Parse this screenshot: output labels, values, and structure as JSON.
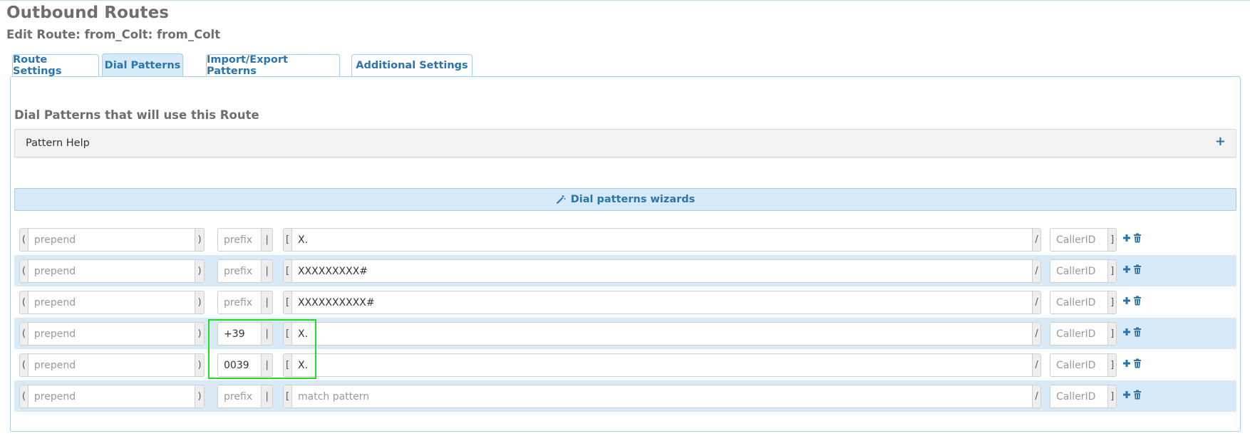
{
  "page": {
    "title": "Outbound Routes",
    "subtitle": "Edit Route: from_Colt: from_Colt"
  },
  "tabs": [
    {
      "label": "Route Settings",
      "active": false
    },
    {
      "label": "Dial Patterns",
      "active": true
    },
    {
      "label": "Import/Export Patterns",
      "active": false
    },
    {
      "label": "Additional Settings",
      "active": false
    }
  ],
  "section": {
    "title": "Dial Patterns that will use this Route",
    "help_label": "Pattern Help",
    "help_icon": "plus-icon",
    "wizard_label": "Dial patterns wizards",
    "wizard_icon": "magic-wand-icon"
  },
  "field_affixes": {
    "prepend_open": "(",
    "prepend_close": ")",
    "prefix_sep": "|",
    "match_open": "[",
    "match_sep": "/",
    "cid_close": "]"
  },
  "placeholders": {
    "prepend": "prepend",
    "prefix": "prefix",
    "match": "match pattern",
    "callerid": "CallerID"
  },
  "rows": [
    {
      "prepend": "",
      "prefix": "",
      "match": "X.",
      "callerid": ""
    },
    {
      "prepend": "",
      "prefix": "",
      "match": "XXXXXXXXX#",
      "callerid": ""
    },
    {
      "prepend": "",
      "prefix": "",
      "match": "XXXXXXXXXX#",
      "callerid": ""
    },
    {
      "prepend": "",
      "prefix": "+39",
      "match": "X.",
      "callerid": ""
    },
    {
      "prepend": "",
      "prefix": "0039",
      "match": "X.",
      "callerid": ""
    },
    {
      "prepend": "",
      "prefix": "",
      "match": "",
      "callerid": ""
    }
  ],
  "row_actions": {
    "add_icon": "plus-icon",
    "delete_icon": "trash-icon"
  },
  "colors": {
    "accent": "#2a74b0",
    "tab_active_bg": "#d8eaf8",
    "row_alt_bg": "#d8eaf8",
    "highlight": "#22dd22"
  }
}
